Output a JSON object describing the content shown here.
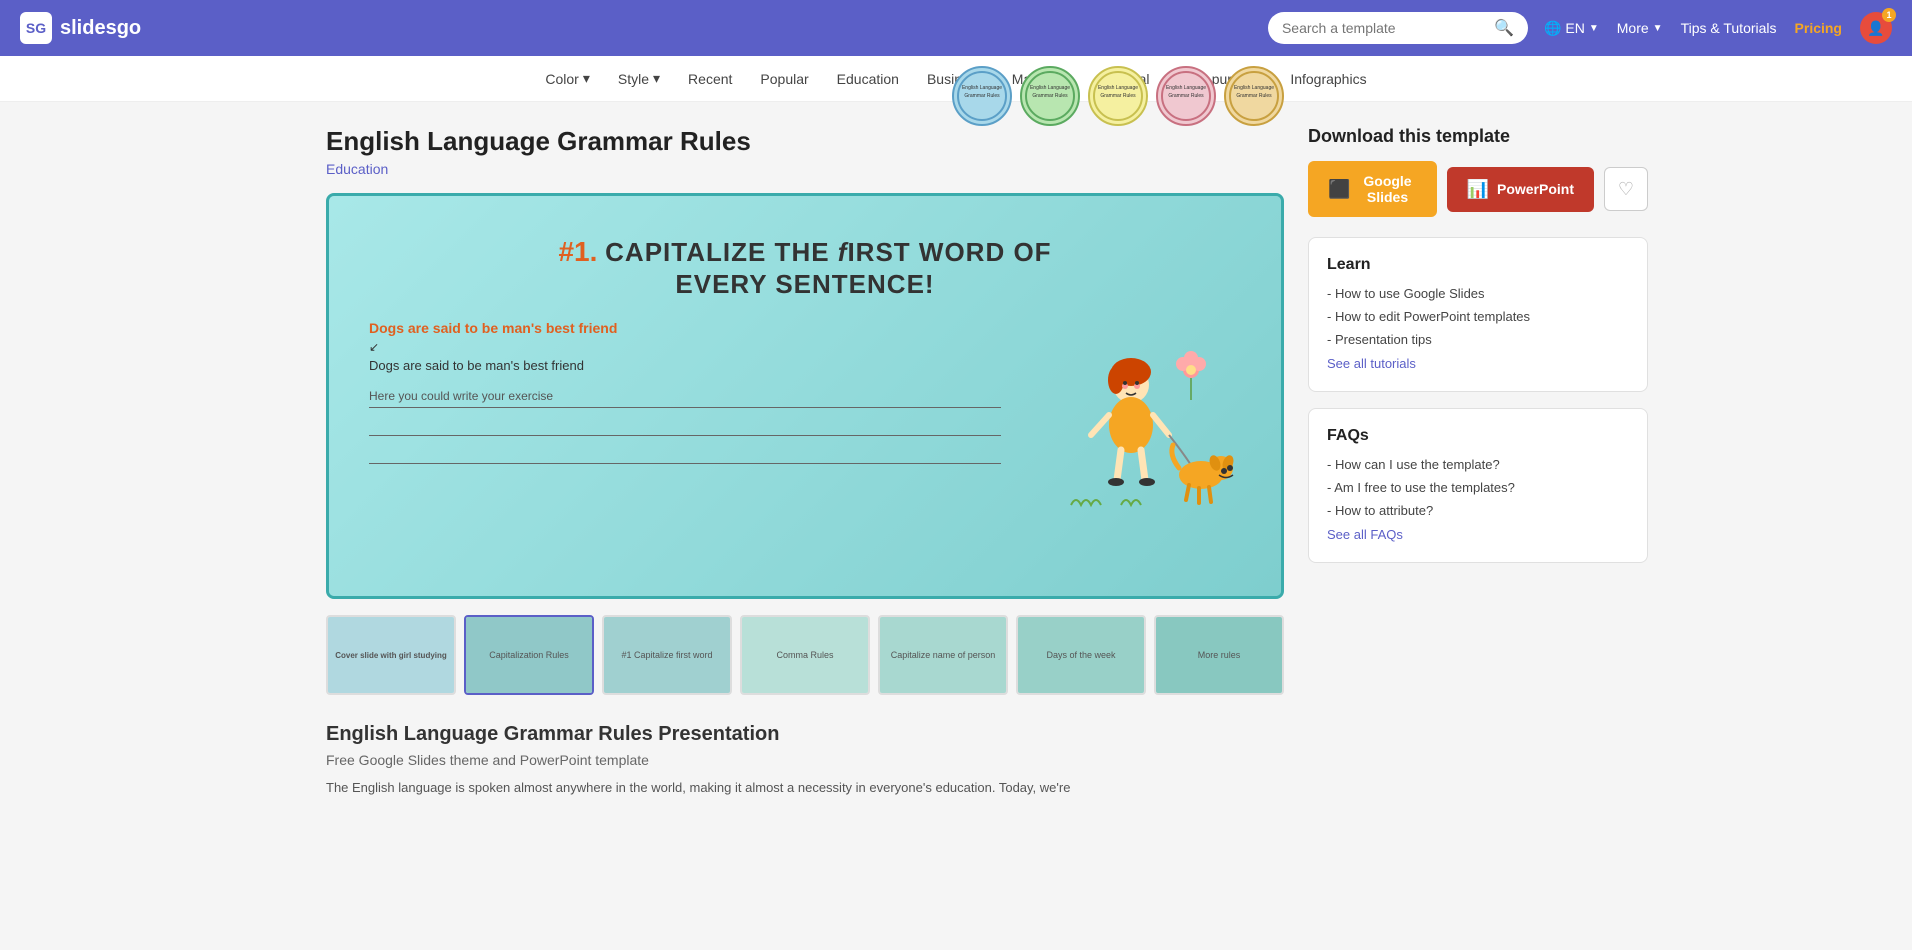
{
  "header": {
    "logo_text": "slidesgo",
    "search_placeholder": "Search a template",
    "lang": "EN",
    "more_label": "More",
    "tips_label": "Tips & Tutorials",
    "pricing_label": "Pricing",
    "notif_count": "1"
  },
  "navbar": {
    "items": [
      {
        "label": "Color",
        "has_arrow": true
      },
      {
        "label": "Style",
        "has_arrow": true
      },
      {
        "label": "Recent",
        "has_arrow": false
      },
      {
        "label": "Popular",
        "has_arrow": false
      },
      {
        "label": "Education",
        "has_arrow": false
      },
      {
        "label": "Business",
        "has_arrow": false
      },
      {
        "label": "Marketing",
        "has_arrow": false
      },
      {
        "label": "Medical",
        "has_arrow": false
      },
      {
        "label": "Multi-purpose",
        "has_arrow": false
      },
      {
        "label": "Infographics",
        "has_arrow": false
      }
    ]
  },
  "template": {
    "title": "English Language Grammar Rules",
    "category": "Education",
    "slide_title_number": "#1.",
    "slide_title_text": "Capitalize the first word of every sentence!",
    "slide_wrong_example": "Dogs are said to be man's best friend",
    "slide_correct_example": "Dogs are said to be man's best friend",
    "slide_exercise_placeholder": "Here you could write your exercise"
  },
  "download": {
    "title": "Download this template",
    "google_slides_label": "Google Slides",
    "powerpoint_label": "PowerPoint"
  },
  "learn": {
    "title": "Learn",
    "links": [
      "- How to use Google Slides",
      "- How to edit PowerPoint templates",
      "- Presentation tips"
    ],
    "see_all": "See all tutorials"
  },
  "faqs": {
    "title": "FAQs",
    "links": [
      "- How can I use the template?",
      "- Am I free to use the templates?",
      "- How to attribute?"
    ],
    "see_all": "See all FAQs"
  },
  "description": {
    "section_title": "English Language Grammar Rules Presentation",
    "section_subtitle": "Free Google Slides theme and PowerPoint template",
    "body": "The English language is spoken almost anywhere in the world, making it almost a necessity in everyone's education. Today, we're"
  },
  "thumbnails": {
    "strip": [
      {
        "label": "Slide 1 - Cover"
      },
      {
        "label": "Slide 2 - Capitalization Rules"
      },
      {
        "label": "Slide 3 - Capitalize First Word"
      },
      {
        "label": "Slide 4 - Comma Rules"
      },
      {
        "label": "Slide 5 - Capitalize Names"
      },
      {
        "label": "Slide 6 - Days of the Week"
      },
      {
        "label": "Slide 7 - More Rules"
      }
    ]
  }
}
